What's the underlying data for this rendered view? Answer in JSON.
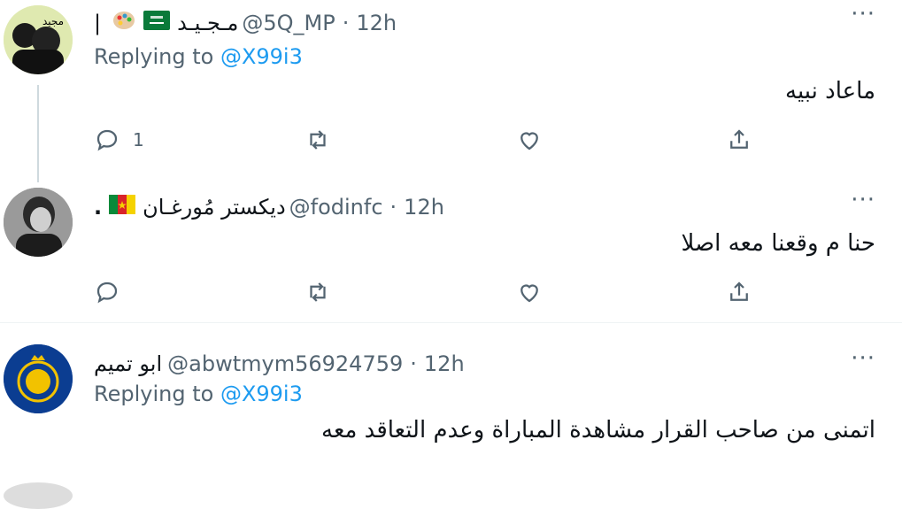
{
  "colors": {
    "accent": "#1d9bf0",
    "muted": "#536471",
    "text": "#0f1419"
  },
  "tweets": [
    {
      "name": "مـجـيـد",
      "handle": "@5Q_MP",
      "dot": "·",
      "time": "12h",
      "extra": "|",
      "replying_label": "Replying to",
      "replying_to": "@X99i3",
      "text": "ماعاد نبيه",
      "reply_count": "1",
      "more": "···",
      "avatar_text": "مجيد"
    },
    {
      "name": "ديكستر مُورغـان",
      "handle": "@fodinfc",
      "dot": "·",
      "time": "12h",
      "extra": ".",
      "text": "حنا م وقعنا معه اصلا",
      "reply_count": "",
      "more": "···"
    },
    {
      "name": "ابو تميم",
      "handle": "@abwtmym56924759",
      "dot": "·",
      "time": "12h",
      "replying_label": "Replying to",
      "replying_to": "@X99i3",
      "text": "اتمنى من صاحب القرار مشاهدة المباراة وعدم التعاقد معه",
      "more": "···"
    }
  ],
  "icons": {
    "reply": "reply-icon",
    "retweet": "retweet-icon",
    "like": "heart-icon",
    "share": "share-icon",
    "more": "more-icon"
  }
}
